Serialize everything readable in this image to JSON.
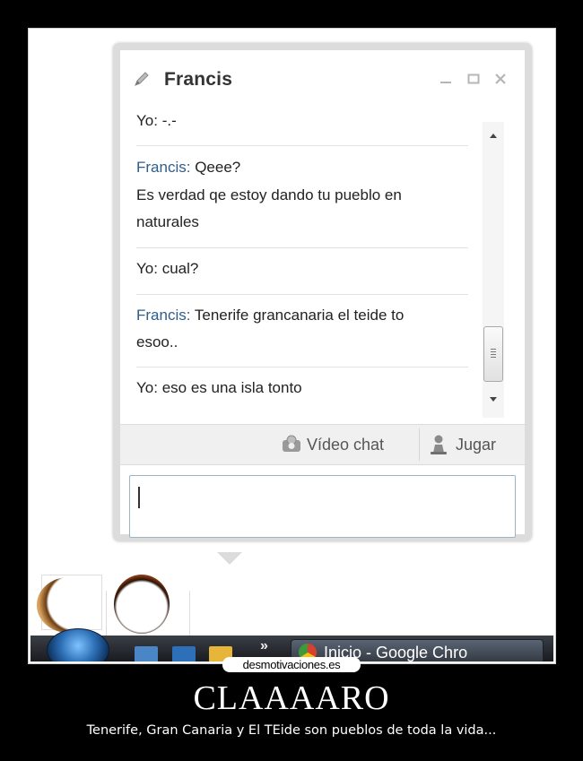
{
  "chat": {
    "title": "Francis",
    "messages": [
      {
        "sender": "Yo:",
        "text": " -.-",
        "from_other": false
      },
      {
        "sender": "Francis:",
        "text": " Qeee?",
        "from_other": true
      },
      {
        "sender": "",
        "text": "Es verdad qe estoy dando tu pueblo en",
        "from_other": true
      },
      {
        "sender": "",
        "text": "naturales",
        "from_other": true
      },
      {
        "sender": "Yo:",
        "text": " cual?",
        "from_other": false
      },
      {
        "sender": "Francis:",
        "text": " Tenerife grancanaria el teide to",
        "from_other": true
      },
      {
        "sender": "",
        "text": "esoo..",
        "from_other": true
      },
      {
        "sender": "Yo:",
        "text": " eso es una isla tonto",
        "from_other": false
      }
    ],
    "actions": {
      "video_chat": "Vídeo chat",
      "play": "Jugar"
    }
  },
  "taskbar": {
    "overflow_label": "»",
    "active_window_label": "Inicio - Google Chro"
  },
  "watermark": "desmotivaciones.es",
  "poster": {
    "title": "CLAAAARO",
    "subtitle": "Tenerife, Gran Canaria y El TEide son pueblos de toda la vida..."
  },
  "colors": {
    "other_sender": "#2f5d8a",
    "background": "#000000"
  }
}
